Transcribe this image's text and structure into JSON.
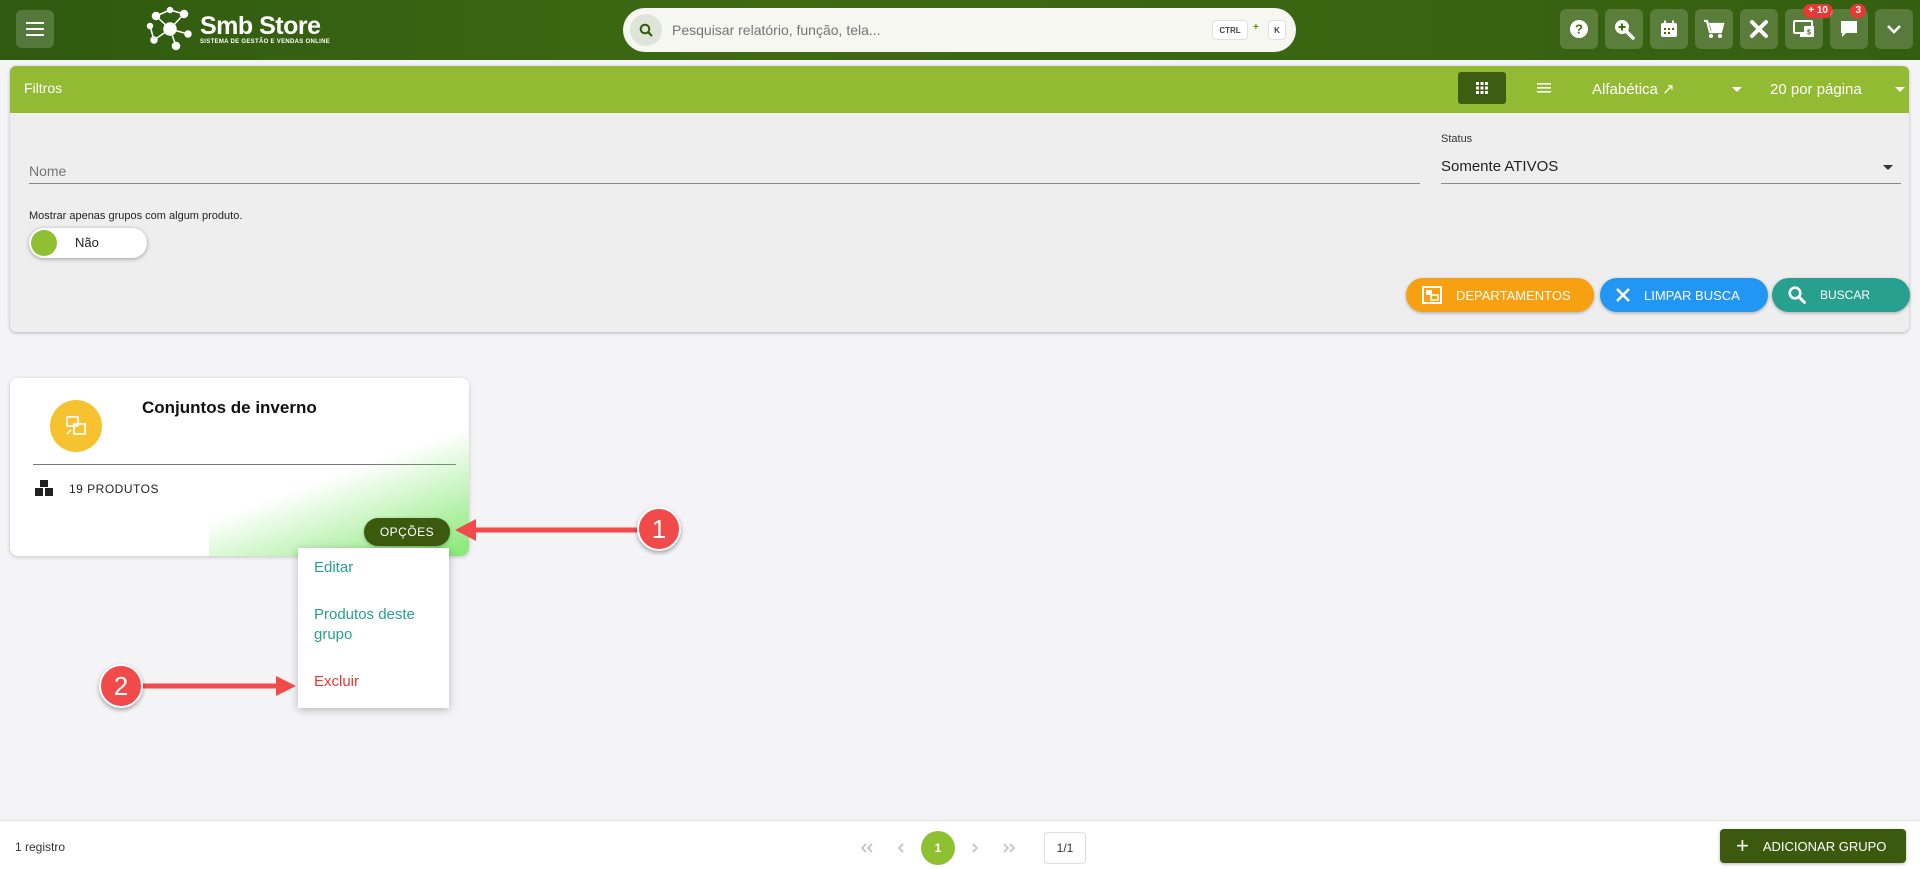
{
  "header": {
    "brand_title": "Smb Store",
    "brand_subtitle": "SISTEMA DE GESTÃO E VENDAS ONLINE",
    "search_placeholder": "Pesquisar relatório, função, tela...",
    "shortcut_ctrl": "CTRL",
    "shortcut_plus": "+",
    "shortcut_key": "K",
    "icons": [
      {
        "name": "help-icon"
      },
      {
        "name": "zoom-icon"
      },
      {
        "name": "calendar-icon"
      },
      {
        "name": "cart-icon"
      },
      {
        "name": "tools-icon"
      },
      {
        "name": "monitor-icon",
        "badge": "+ 10"
      },
      {
        "name": "chat-icon",
        "badge": "3"
      },
      {
        "name": "chevron-down-icon"
      }
    ],
    "colors": {
      "bar": "#3f6a12",
      "badge": "#e53935"
    }
  },
  "filters": {
    "title": "Filtros",
    "sort_label": "Alfabética ↗",
    "per_page_label": "20 por página",
    "nome_placeholder": "Nome",
    "status_label": "Status",
    "status_value": "Somente ATIVOS",
    "toggle_caption": "Mostrar apenas grupos com algum produto.",
    "toggle_value": "Não",
    "buttons": {
      "departments": "DEPARTAMENTOS",
      "clear": "LIMPAR BUSCA",
      "search": "BUSCAR"
    },
    "colors": {
      "header": "#93ba33",
      "departments": "#f7a012",
      "clear": "#2196f3",
      "search": "#27a08f"
    }
  },
  "card": {
    "title": "Conjuntos de inverno",
    "products": "19 PRODUTOS",
    "options_label": "OPÇÕES"
  },
  "options_menu": {
    "items": [
      "Editar",
      "Produtos deste grupo",
      "Excluir"
    ]
  },
  "annotations": [
    {
      "label": "1"
    },
    {
      "label": "2"
    }
  ],
  "footer": {
    "count": "1 registro",
    "current_page": "1",
    "page_total": "1/1",
    "add_label": "ADICIONAR GRUPO"
  }
}
